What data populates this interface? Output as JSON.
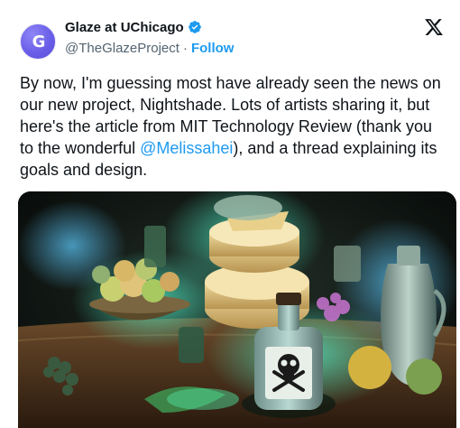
{
  "author": {
    "avatar_letter": "G",
    "display_name": "Glaze at UChicago",
    "handle": "@TheGlazeProject",
    "separator": "·",
    "follow_label": "Follow",
    "verified": true
  },
  "post": {
    "text_before": "By now, I'm guessing most have already seen the news on our new project, Nightshade. Lots of artists sharing it, but here's the article from MIT Technology Review (thank you to the wonderful ",
    "mention": "@Melissahei",
    "text_after": "), and a thread explaining its goals and design."
  },
  "colors": {
    "link": "#1d9bf0",
    "text": "#0f1419",
    "secondary": "#536471",
    "verified": "#1d9bf0",
    "avatar": "#6a5ee8"
  },
  "icons": {
    "verified": "verified-badge-icon",
    "platform": "x-logo-icon"
  }
}
